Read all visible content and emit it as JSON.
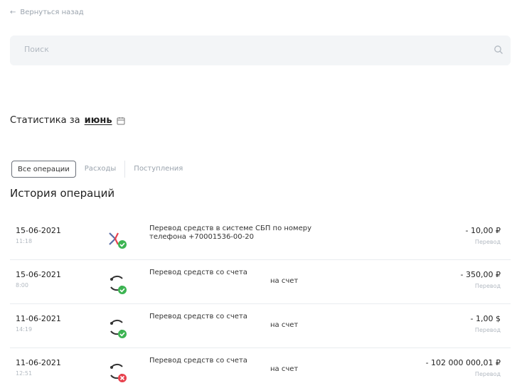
{
  "nav": {
    "back_label": "Вернуться назад"
  },
  "search": {
    "placeholder": "Поиск"
  },
  "stats": {
    "prefix": "Статистика за",
    "month": "июнь"
  },
  "filters": {
    "tabs": [
      "Все операции",
      "Расходы",
      "Поступления"
    ],
    "active": 0
  },
  "history": {
    "title": "История операций",
    "operations": [
      {
        "date": "15-06-2021",
        "time": "11:18",
        "line1": "Перевод средств в системе СБП по номеру",
        "line2": "телефона +70001536-00-20",
        "amount": "- 10,00 ₽",
        "category": "Перевод",
        "icon": "sbp-icon",
        "status": "success"
      },
      {
        "date": "15-06-2021",
        "time": "8:00",
        "line1": "Перевод средств со счета",
        "line2": "на счет",
        "amount": "- 350,00 ₽",
        "category": "Перевод",
        "icon": "transfer-icon",
        "status": "success"
      },
      {
        "date": "11-06-2021",
        "time": "14:19",
        "line1": "Перевод средств со счета",
        "line2": "на счет",
        "amount": "- 1,00 $",
        "category": "Перевод",
        "icon": "transfer-icon",
        "status": "success"
      },
      {
        "date": "11-06-2021",
        "time": "12:51",
        "line1": "Перевод средств со счета",
        "line2": "на счет",
        "amount": "- 102 000 000,01 ₽",
        "category": "Перевод",
        "icon": "transfer-icon",
        "status": "failed"
      }
    ]
  },
  "colors": {
    "success": "#3cb452",
    "failed": "#e8424e",
    "sbp_arrow": "#5a6ea8"
  }
}
